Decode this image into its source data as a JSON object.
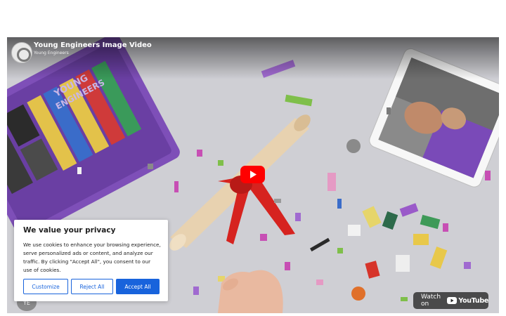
{
  "video": {
    "title": "Young Engineers Image Video",
    "channel": "Young Engineers",
    "watch_on_label": "Watch on",
    "youtube_wordmark": "YouTube",
    "overlay_avatar_text": "YE",
    "logo_text_line1": "YOUNG",
    "logo_text_line2": "ENGINEERS",
    "colors": {
      "youtube_red": "#ff0000",
      "tray_purple": "#7e4fb8",
      "ribbon_red": "#d6231f"
    }
  },
  "cookie_banner": {
    "title": "We value your privacy",
    "body": "We use cookies to enhance your browsing experience, serve personalized ads or content, and analyze our traffic. By clicking \"Accept All\", you consent to our use of cookies.",
    "buttons": {
      "customize": "Customize",
      "reject": "Reject All",
      "accept": "Accept All"
    },
    "accent_color": "#1863dc"
  },
  "icons": [
    "youtube-play-icon",
    "youtube-logo-icon",
    "channel-avatar-icon"
  ]
}
